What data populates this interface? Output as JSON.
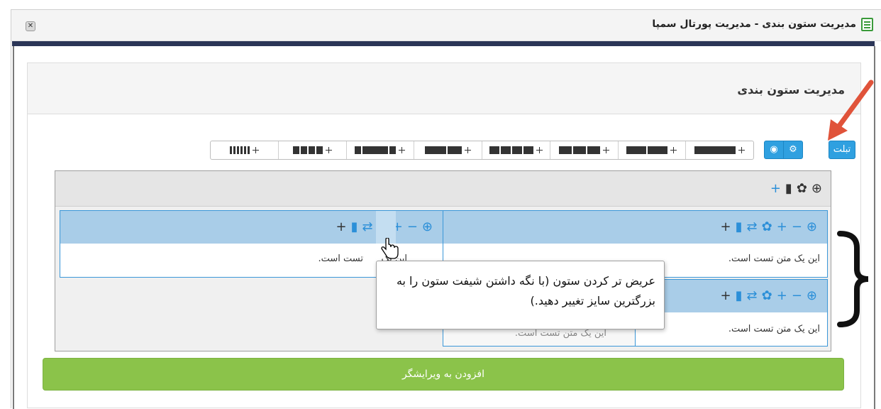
{
  "window": {
    "title": "مدیریت ستون بندی - مدیریت پورتال سمپا",
    "close_label": "✕"
  },
  "panel": {
    "title": "مدیریت ستون بندی"
  },
  "toolbar": {
    "tablet_label": "تبلت",
    "gear_icon": "gear-icon",
    "eye_icon": "eye-icon"
  },
  "layouts": [
    {
      "name": "layout-12"
    },
    {
      "name": "layout-6-6"
    },
    {
      "name": "layout-4-8"
    },
    {
      "name": "layout-8-4"
    },
    {
      "name": "layout-4-4-4"
    },
    {
      "name": "layout-3-6-3"
    },
    {
      "name": "layout-3-3-3-3"
    },
    {
      "name": "layout-2-2-2-2-2-2"
    }
  ],
  "columns": {
    "text": "این یک متن تست است.",
    "left_text_visible": "تست است.",
    "left_text_fragment": "این یک",
    "inner_text_fragment": "این یک متن تست است."
  },
  "tooltip": {
    "text": "عریض تر کردن ستون (با نگه داشتن شیفت ستون را به بزرگترین سایز تغییر دهید.)"
  },
  "add_button": {
    "label": "افزودن به ویرایشگر"
  },
  "colors": {
    "primary": "#2fa0e0",
    "success": "#8bc34a",
    "column_header": "#a9cde8",
    "navbar": "#2b3557",
    "arrow": "#e0533a"
  }
}
